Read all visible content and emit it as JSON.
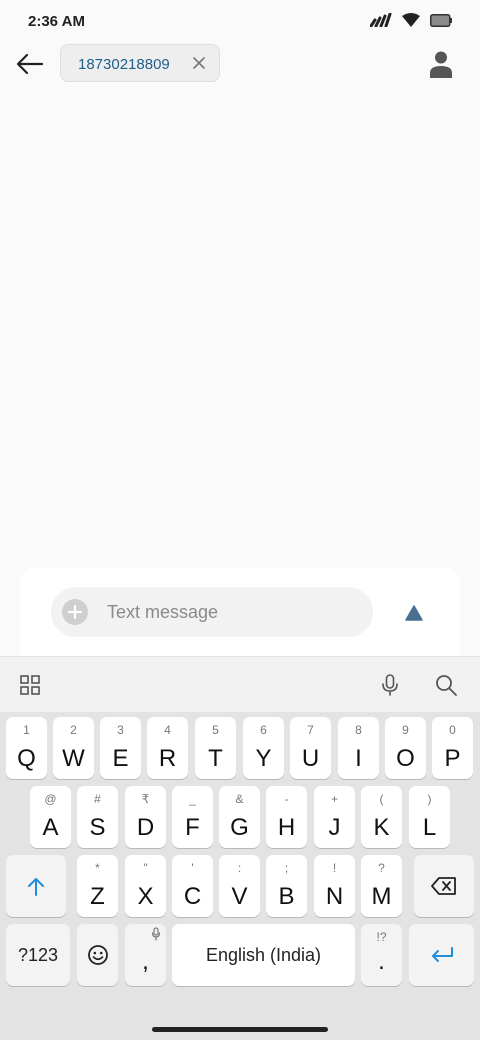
{
  "status_bar": {
    "time": "2:36 AM"
  },
  "header": {
    "recipient_chip": "18730218809"
  },
  "compose": {
    "placeholder": "Text message"
  },
  "keyboard": {
    "row1": [
      {
        "hint": "1",
        "main": "Q"
      },
      {
        "hint": "2",
        "main": "W"
      },
      {
        "hint": "3",
        "main": "E"
      },
      {
        "hint": "4",
        "main": "R"
      },
      {
        "hint": "5",
        "main": "T"
      },
      {
        "hint": "6",
        "main": "Y"
      },
      {
        "hint": "7",
        "main": "U"
      },
      {
        "hint": "8",
        "main": "I"
      },
      {
        "hint": "9",
        "main": "O"
      },
      {
        "hint": "0",
        "main": "P"
      }
    ],
    "row2": [
      {
        "hint": "@",
        "main": "A"
      },
      {
        "hint": "#",
        "main": "S"
      },
      {
        "hint": "₹",
        "main": "D"
      },
      {
        "hint": "_",
        "main": "F"
      },
      {
        "hint": "&",
        "main": "G"
      },
      {
        "hint": "-",
        "main": "H"
      },
      {
        "hint": "+",
        "main": "J"
      },
      {
        "hint": "(",
        "main": "K"
      },
      {
        "hint": ")",
        "main": "L"
      }
    ],
    "row3": [
      {
        "hint": "*",
        "main": "Z"
      },
      {
        "hint": "\"",
        "main": "X"
      },
      {
        "hint": "'",
        "main": "C"
      },
      {
        "hint": ":",
        "main": "V"
      },
      {
        "hint": ";",
        "main": "B"
      },
      {
        "hint": "!",
        "main": "N"
      },
      {
        "hint": "?",
        "main": "M"
      }
    ],
    "symbols_label": "?123",
    "comma": ",",
    "space_label": "English (India)",
    "period_hint": "!?",
    "period": "."
  },
  "colors": {
    "accent": "#1f8fdb",
    "chip_text": "#1f5f8b",
    "send_icon": "#4a6f91"
  },
  "icons": {
    "back": "arrow-left-icon",
    "chip_close": "close-icon",
    "contact": "person-icon",
    "add": "plus-circle-icon",
    "send": "send-icon",
    "apps": "grid-icon",
    "mic": "microphone-icon",
    "search": "search-icon",
    "shift": "shift-icon",
    "backspace": "backspace-icon",
    "emoji": "emoji-icon",
    "enter": "enter-icon"
  }
}
